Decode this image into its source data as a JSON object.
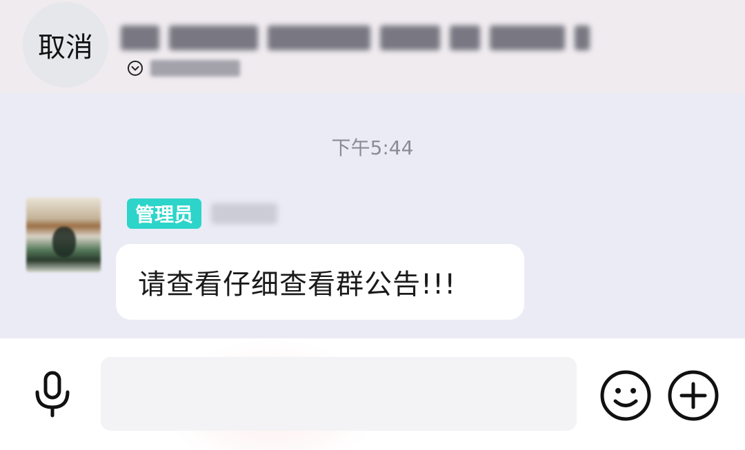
{
  "header": {
    "cancel_label": "取消",
    "chevron_icon": "chevron-down-circle-icon"
  },
  "chat": {
    "timestamp": "下午5:44",
    "messages": [
      {
        "badge": "管理员",
        "text": "请查看仔细查看群公告!!!"
      }
    ]
  },
  "input": {
    "placeholder": "",
    "icons": [
      "microphone-icon",
      "emoji-icon",
      "plus-icon"
    ]
  },
  "colors": {
    "badge_bg": "#2dd4c9",
    "chat_bg": "#ebebf5",
    "header_bg": "#efebef"
  }
}
